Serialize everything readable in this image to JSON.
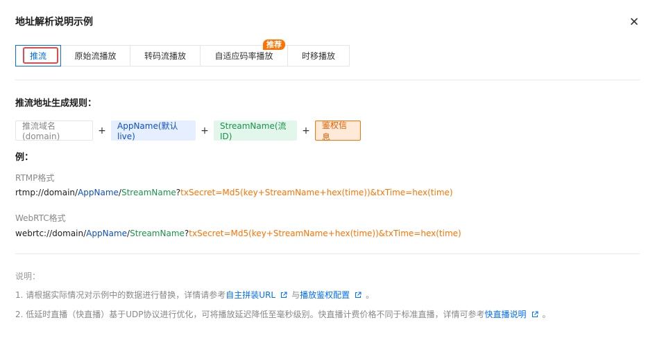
{
  "dialog": {
    "title": "地址解析说明示例"
  },
  "tabs": [
    {
      "label": "推流",
      "active": true
    },
    {
      "label": "原始流播放"
    },
    {
      "label": "转码流播放"
    },
    {
      "label": "自适应码率播放",
      "badge": "推荐"
    },
    {
      "label": "时移播放"
    }
  ],
  "rule": {
    "title": "推流地址生成规则：",
    "domain": "推流域名(domain)",
    "plus": "+",
    "app": "AppName(默认live)",
    "stream": "StreamName(流ID)",
    "auth": "鉴权信息"
  },
  "example": {
    "title": "例：",
    "rtmp": {
      "label": "RTMP格式",
      "prefix": "rtmp://domain/",
      "app": "AppName",
      "slash": "/",
      "stream": "StreamName",
      "q": "?",
      "params": "txSecret=Md5(key+StreamName+hex(time))&txTime=hex(time)"
    },
    "webrtc": {
      "label": "WebRTC格式",
      "prefix": "webrtc://domain/",
      "app": "AppName",
      "slash": "/",
      "stream": "StreamName",
      "q": "?",
      "params": "txSecret=Md5(key+StreamName+hex(time))&txTime=hex(time)"
    }
  },
  "notes": {
    "heading": "说明：",
    "n1": {
      "text": "1. 请根据实际情况对示例中的数据进行替换，详情请参考",
      "link1": "自主拼装URL",
      "mid": "与",
      "link2": "播放鉴权配置",
      "end": "。"
    },
    "n2": {
      "text": "2. 低延时直播（快直播）基于UDP协议进行优化，可将播放延迟降低至毫秒级别。快直播计费价格不同于标准直播，详情可参考",
      "link": "快直播说明",
      "end": "。"
    }
  },
  "colors": {
    "primary": "#006eff",
    "app": "#0f4fc7",
    "stream": "#19934a",
    "auth": "#ff7200",
    "highlight": "#e5474f"
  }
}
